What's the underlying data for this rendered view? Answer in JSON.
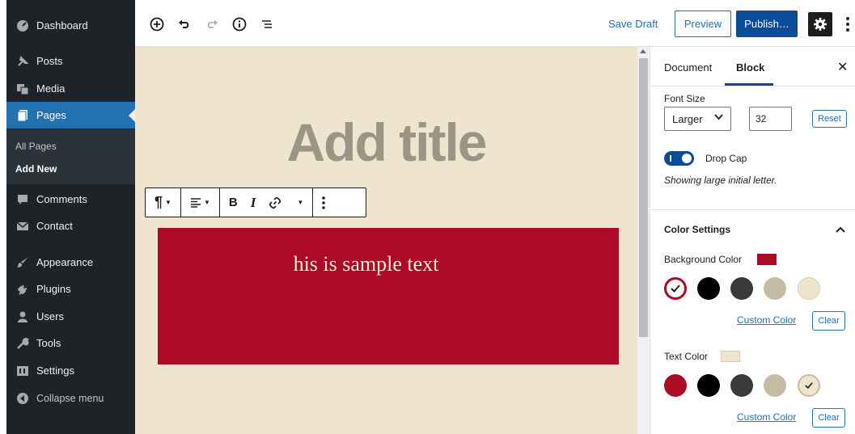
{
  "sidebar": {
    "items": [
      {
        "label": "Dashboard",
        "icon": "dashboard-icon"
      },
      {
        "label": "Posts",
        "icon": "pin-icon"
      },
      {
        "label": "Media",
        "icon": "media-icon"
      },
      {
        "label": "Pages",
        "icon": "pages-icon"
      },
      {
        "label": "Comments",
        "icon": "comment-icon"
      },
      {
        "label": "Contact",
        "icon": "mail-icon"
      },
      {
        "label": "Appearance",
        "icon": "brush-icon"
      },
      {
        "label": "Plugins",
        "icon": "plug-icon"
      },
      {
        "label": "Users",
        "icon": "user-icon"
      },
      {
        "label": "Tools",
        "icon": "wrench-icon"
      },
      {
        "label": "Settings",
        "icon": "settings-icon"
      },
      {
        "label": "Collapse menu",
        "icon": "collapse-icon"
      }
    ],
    "submenu": [
      {
        "label": "All Pages"
      },
      {
        "label": "Add New"
      }
    ]
  },
  "toolbar": {
    "save_draft": "Save Draft",
    "preview": "Preview",
    "publish": "Publish…"
  },
  "editor": {
    "title_placeholder": "Add title",
    "block_text": "his is sample text"
  },
  "panel": {
    "tabs": [
      {
        "label": "Document"
      },
      {
        "label": "Block"
      }
    ],
    "font_size_label": "Font Size",
    "font_size_select": "Larger",
    "font_size_value": "32",
    "reset": "Reset",
    "drop_cap_label": "Drop Cap",
    "drop_cap_help": "Showing large initial letter.",
    "color_settings_title": "Color Settings",
    "background_color_label": "Background Color",
    "text_color_label": "Text Color",
    "custom_color": "Custom Color",
    "clear": "Clear"
  },
  "colors": {
    "accent": "#0a4b9a",
    "admin_active": "#2271b1",
    "block_background": "#ad0a26",
    "canvas_background": "#efe5cf",
    "palette": [
      "#ad0a26",
      "#000000",
      "#3a3a3a",
      "#c5bba4",
      "#efe5cf"
    ]
  }
}
